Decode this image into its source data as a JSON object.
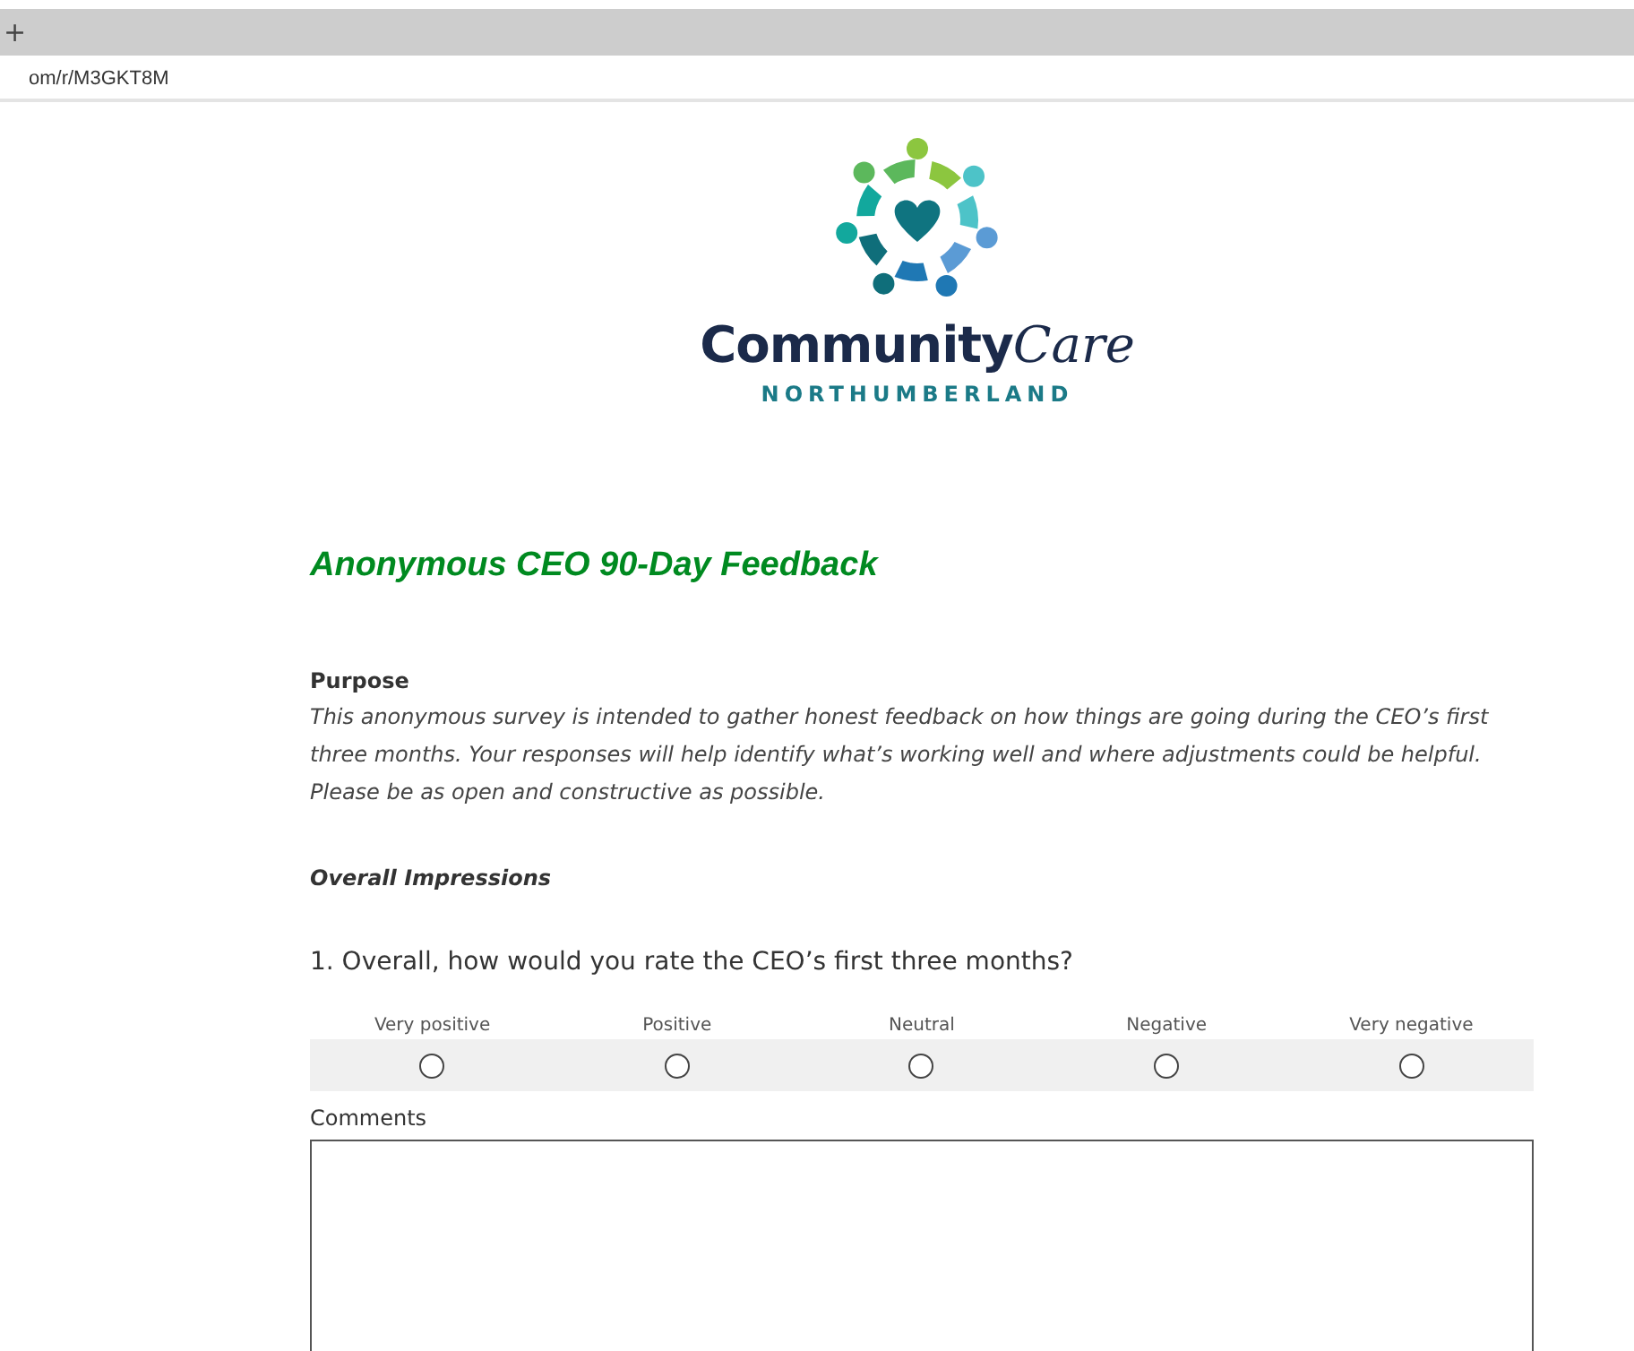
{
  "browser": {
    "new_tab": "+",
    "address": "om/r/M3GKT8M"
  },
  "logo": {
    "word": "Community",
    "script_word": "Care",
    "region": "NORTHUMBERLAND"
  },
  "title": "Anonymous CEO 90-Day Feedback",
  "purpose": {
    "heading": "Purpose",
    "text": "This anonymous survey is intended to gather honest feedback on how things are going during the CEO’s first three months. Your responses will help identify what’s working well and where adjustments could be helpful. Please be as open and constructive as possible."
  },
  "section": "Overall Impressions",
  "question": {
    "text": "1. Overall, how would you rate the CEO’s first three months?",
    "options": [
      {
        "label": "Very positive",
        "selected": false
      },
      {
        "label": "Positive",
        "selected": false
      },
      {
        "label": "Neutral",
        "selected": false
      },
      {
        "label": "Negative",
        "selected": false
      },
      {
        "label": "Very negative",
        "selected": false
      }
    ],
    "comments_label": "Comments"
  }
}
